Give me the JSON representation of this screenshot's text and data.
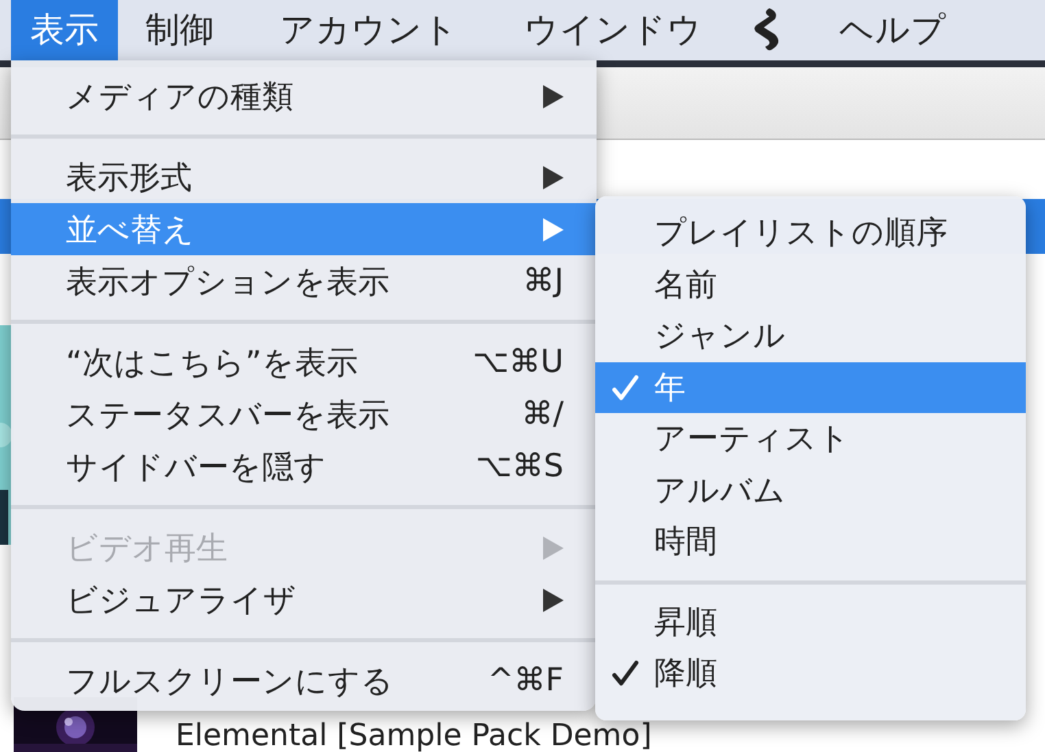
{
  "menubar": {
    "items": [
      {
        "kind": "text",
        "label": "表示",
        "selected": true
      },
      {
        "kind": "text",
        "label": "制御",
        "selected": false
      },
      {
        "kind": "text",
        "label": "アカウント",
        "selected": false
      },
      {
        "kind": "text",
        "label": "ウインドウ",
        "selected": false
      },
      {
        "kind": "logo",
        "selected": false
      },
      {
        "kind": "text",
        "label": "ヘルプ",
        "selected": false
      }
    ]
  },
  "background": {
    "track_title": "Elemental [Sample Pack Demo]"
  },
  "menu": {
    "groups": [
      [
        {
          "label": "メディアの種類",
          "has_submenu": true,
          "disabled": false,
          "selected": false
        }
      ],
      [
        {
          "label": "表示形式",
          "has_submenu": true,
          "disabled": false,
          "selected": false
        },
        {
          "label": "並べ替え",
          "has_submenu": true,
          "disabled": false,
          "selected": true
        },
        {
          "label": "表示オプションを表示",
          "shortcut": "⌘J",
          "has_submenu": false,
          "disabled": false,
          "selected": false
        }
      ],
      [
        {
          "label": "“次はこちら”を表示",
          "shortcut": "⌥⌘U",
          "has_submenu": false,
          "disabled": false,
          "selected": false
        },
        {
          "label": "ステータスバーを表示",
          "shortcut": "⌘/",
          "has_submenu": false,
          "disabled": false,
          "selected": false
        },
        {
          "label": "サイドバーを隠す",
          "shortcut": "⌥⌘S",
          "has_submenu": false,
          "disabled": false,
          "selected": false
        }
      ],
      [
        {
          "label": "ビデオ再生",
          "has_submenu": true,
          "disabled": true,
          "selected": false
        },
        {
          "label": "ビジュアライザ",
          "has_submenu": true,
          "disabled": false,
          "selected": false
        }
      ],
      [
        {
          "label": "フルスクリーンにする",
          "shortcut": "^⌘F",
          "has_submenu": false,
          "disabled": false,
          "selected": false
        }
      ]
    ]
  },
  "submenu": {
    "groups": [
      [
        {
          "label": "プレイリストの順序",
          "checked": false,
          "selected": false
        },
        {
          "label": "名前",
          "checked": false,
          "selected": false
        },
        {
          "label": "ジャンル",
          "checked": false,
          "selected": false
        },
        {
          "label": "年",
          "checked": true,
          "selected": true
        },
        {
          "label": "アーティスト",
          "checked": false,
          "selected": false
        },
        {
          "label": "アルバム",
          "checked": false,
          "selected": false
        },
        {
          "label": "時間",
          "checked": false,
          "selected": false
        }
      ],
      [
        {
          "label": "昇順",
          "checked": false,
          "selected": false
        },
        {
          "label": "降順",
          "checked": true,
          "selected": false
        }
      ]
    ]
  }
}
